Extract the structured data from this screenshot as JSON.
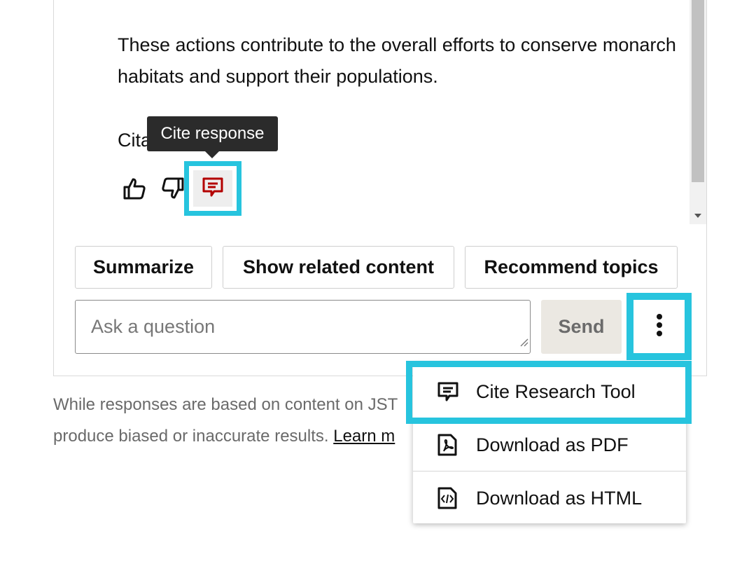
{
  "response": {
    "text": "These actions contribute to the overall efforts to conserve monarch habitats and support their populations.",
    "citation_label": "Cita",
    "tooltip": "Cite response"
  },
  "actions": {
    "summarize": "Summarize",
    "related": "Show related content",
    "recommend": "Recommend topics"
  },
  "input": {
    "placeholder": "Ask a question",
    "send_label": "Send"
  },
  "disclaimer": {
    "line1": "While responses are based on content on JST",
    "line2": "produce biased or inaccurate results.",
    "link": "Learn m"
  },
  "menu": {
    "items": [
      {
        "label": "Cite Research Tool",
        "icon": "cite-icon"
      },
      {
        "label": "Download as PDF",
        "icon": "pdf-file-icon"
      },
      {
        "label": "Download as HTML",
        "icon": "html-file-icon"
      }
    ]
  },
  "colors": {
    "highlight": "#27c4de",
    "cite_icon": "#b30000",
    "send_bg": "#ebe8e2"
  }
}
